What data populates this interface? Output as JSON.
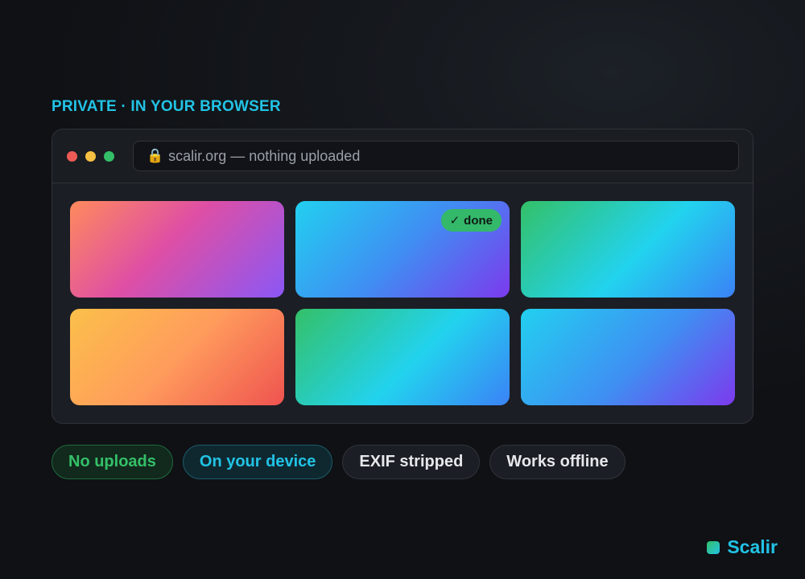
{
  "eyebrow": "PRIVATE · IN YOUR BROWSER",
  "window": {
    "controls": [
      "close",
      "minimize",
      "maximize"
    ],
    "address_bar": {
      "icon": "lock-icon",
      "text": "scalir.org — nothing uploaded"
    },
    "tiles": [
      {
        "id": 1,
        "gradient": [
          "#ff8a5c",
          "#de4fa5",
          "#8a57f5"
        ]
      },
      {
        "id": 2,
        "gradient": [
          "#22d0f0",
          "#3f8ff2",
          "#7c3aed"
        ],
        "badge": {
          "check": "✓",
          "label": "done"
        }
      },
      {
        "id": 3,
        "gradient": [
          "#34c068",
          "#22d3ee",
          "#3b82f6"
        ]
      },
      {
        "id": 4,
        "gradient": [
          "#fbc04a",
          "#ff9c5c",
          "#ef5350"
        ]
      },
      {
        "id": 5,
        "gradient": [
          "#34c068",
          "#22d3ee",
          "#3b82f6"
        ]
      },
      {
        "id": 6,
        "gradient": [
          "#22d0f0",
          "#3f8ff2",
          "#7c3aed"
        ]
      }
    ]
  },
  "features": [
    {
      "label": "No uploads",
      "color": "#34c068"
    },
    {
      "label": "On your device",
      "color": "#22c3e6"
    },
    {
      "label": "EXIF stripped",
      "color": "#e5e7eb"
    },
    {
      "label": "Works offline",
      "color": "#e5e7eb"
    }
  ],
  "brand": {
    "name": "Scalir",
    "color": "#22c3e6"
  }
}
